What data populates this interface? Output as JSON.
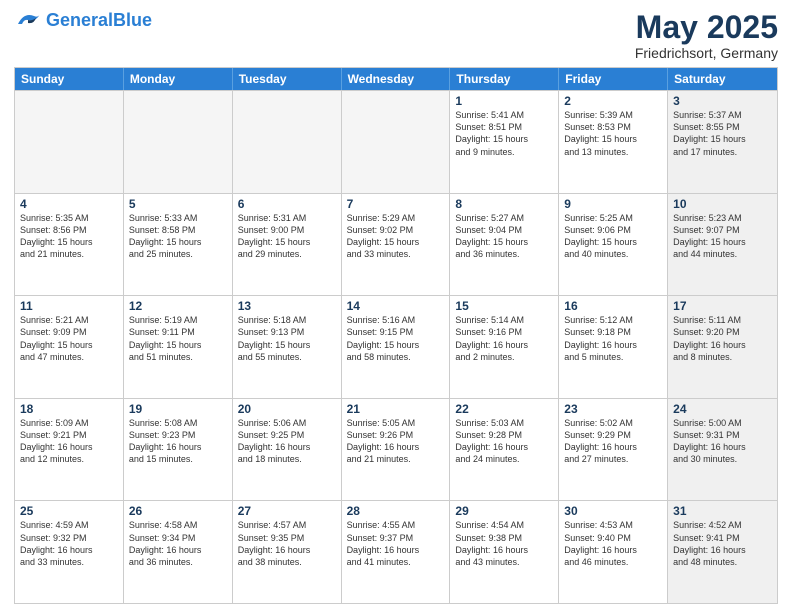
{
  "logo": {
    "line1": "General",
    "line2": "Blue"
  },
  "title": "May 2025",
  "subtitle": "Friedrichsort, Germany",
  "header_days": [
    "Sunday",
    "Monday",
    "Tuesday",
    "Wednesday",
    "Thursday",
    "Friday",
    "Saturday"
  ],
  "weeks": [
    [
      {
        "day": "",
        "info": "",
        "shaded": true
      },
      {
        "day": "",
        "info": "",
        "shaded": true
      },
      {
        "day": "",
        "info": "",
        "shaded": true
      },
      {
        "day": "",
        "info": "",
        "shaded": true
      },
      {
        "day": "1",
        "info": "Sunrise: 5:41 AM\nSunset: 8:51 PM\nDaylight: 15 hours\nand 9 minutes.",
        "shaded": false
      },
      {
        "day": "2",
        "info": "Sunrise: 5:39 AM\nSunset: 8:53 PM\nDaylight: 15 hours\nand 13 minutes.",
        "shaded": false
      },
      {
        "day": "3",
        "info": "Sunrise: 5:37 AM\nSunset: 8:55 PM\nDaylight: 15 hours\nand 17 minutes.",
        "shaded": true
      }
    ],
    [
      {
        "day": "4",
        "info": "Sunrise: 5:35 AM\nSunset: 8:56 PM\nDaylight: 15 hours\nand 21 minutes.",
        "shaded": false
      },
      {
        "day": "5",
        "info": "Sunrise: 5:33 AM\nSunset: 8:58 PM\nDaylight: 15 hours\nand 25 minutes.",
        "shaded": false
      },
      {
        "day": "6",
        "info": "Sunrise: 5:31 AM\nSunset: 9:00 PM\nDaylight: 15 hours\nand 29 minutes.",
        "shaded": false
      },
      {
        "day": "7",
        "info": "Sunrise: 5:29 AM\nSunset: 9:02 PM\nDaylight: 15 hours\nand 33 minutes.",
        "shaded": false
      },
      {
        "day": "8",
        "info": "Sunrise: 5:27 AM\nSunset: 9:04 PM\nDaylight: 15 hours\nand 36 minutes.",
        "shaded": false
      },
      {
        "day": "9",
        "info": "Sunrise: 5:25 AM\nSunset: 9:06 PM\nDaylight: 15 hours\nand 40 minutes.",
        "shaded": false
      },
      {
        "day": "10",
        "info": "Sunrise: 5:23 AM\nSunset: 9:07 PM\nDaylight: 15 hours\nand 44 minutes.",
        "shaded": true
      }
    ],
    [
      {
        "day": "11",
        "info": "Sunrise: 5:21 AM\nSunset: 9:09 PM\nDaylight: 15 hours\nand 47 minutes.",
        "shaded": false
      },
      {
        "day": "12",
        "info": "Sunrise: 5:19 AM\nSunset: 9:11 PM\nDaylight: 15 hours\nand 51 minutes.",
        "shaded": false
      },
      {
        "day": "13",
        "info": "Sunrise: 5:18 AM\nSunset: 9:13 PM\nDaylight: 15 hours\nand 55 minutes.",
        "shaded": false
      },
      {
        "day": "14",
        "info": "Sunrise: 5:16 AM\nSunset: 9:15 PM\nDaylight: 15 hours\nand 58 minutes.",
        "shaded": false
      },
      {
        "day": "15",
        "info": "Sunrise: 5:14 AM\nSunset: 9:16 PM\nDaylight: 16 hours\nand 2 minutes.",
        "shaded": false
      },
      {
        "day": "16",
        "info": "Sunrise: 5:12 AM\nSunset: 9:18 PM\nDaylight: 16 hours\nand 5 minutes.",
        "shaded": false
      },
      {
        "day": "17",
        "info": "Sunrise: 5:11 AM\nSunset: 9:20 PM\nDaylight: 16 hours\nand 8 minutes.",
        "shaded": true
      }
    ],
    [
      {
        "day": "18",
        "info": "Sunrise: 5:09 AM\nSunset: 9:21 PM\nDaylight: 16 hours\nand 12 minutes.",
        "shaded": false
      },
      {
        "day": "19",
        "info": "Sunrise: 5:08 AM\nSunset: 9:23 PM\nDaylight: 16 hours\nand 15 minutes.",
        "shaded": false
      },
      {
        "day": "20",
        "info": "Sunrise: 5:06 AM\nSunset: 9:25 PM\nDaylight: 16 hours\nand 18 minutes.",
        "shaded": false
      },
      {
        "day": "21",
        "info": "Sunrise: 5:05 AM\nSunset: 9:26 PM\nDaylight: 16 hours\nand 21 minutes.",
        "shaded": false
      },
      {
        "day": "22",
        "info": "Sunrise: 5:03 AM\nSunset: 9:28 PM\nDaylight: 16 hours\nand 24 minutes.",
        "shaded": false
      },
      {
        "day": "23",
        "info": "Sunrise: 5:02 AM\nSunset: 9:29 PM\nDaylight: 16 hours\nand 27 minutes.",
        "shaded": false
      },
      {
        "day": "24",
        "info": "Sunrise: 5:00 AM\nSunset: 9:31 PM\nDaylight: 16 hours\nand 30 minutes.",
        "shaded": true
      }
    ],
    [
      {
        "day": "25",
        "info": "Sunrise: 4:59 AM\nSunset: 9:32 PM\nDaylight: 16 hours\nand 33 minutes.",
        "shaded": false
      },
      {
        "day": "26",
        "info": "Sunrise: 4:58 AM\nSunset: 9:34 PM\nDaylight: 16 hours\nand 36 minutes.",
        "shaded": false
      },
      {
        "day": "27",
        "info": "Sunrise: 4:57 AM\nSunset: 9:35 PM\nDaylight: 16 hours\nand 38 minutes.",
        "shaded": false
      },
      {
        "day": "28",
        "info": "Sunrise: 4:55 AM\nSunset: 9:37 PM\nDaylight: 16 hours\nand 41 minutes.",
        "shaded": false
      },
      {
        "day": "29",
        "info": "Sunrise: 4:54 AM\nSunset: 9:38 PM\nDaylight: 16 hours\nand 43 minutes.",
        "shaded": false
      },
      {
        "day": "30",
        "info": "Sunrise: 4:53 AM\nSunset: 9:40 PM\nDaylight: 16 hours\nand 46 minutes.",
        "shaded": false
      },
      {
        "day": "31",
        "info": "Sunrise: 4:52 AM\nSunset: 9:41 PM\nDaylight: 16 hours\nand 48 minutes.",
        "shaded": true
      }
    ]
  ]
}
